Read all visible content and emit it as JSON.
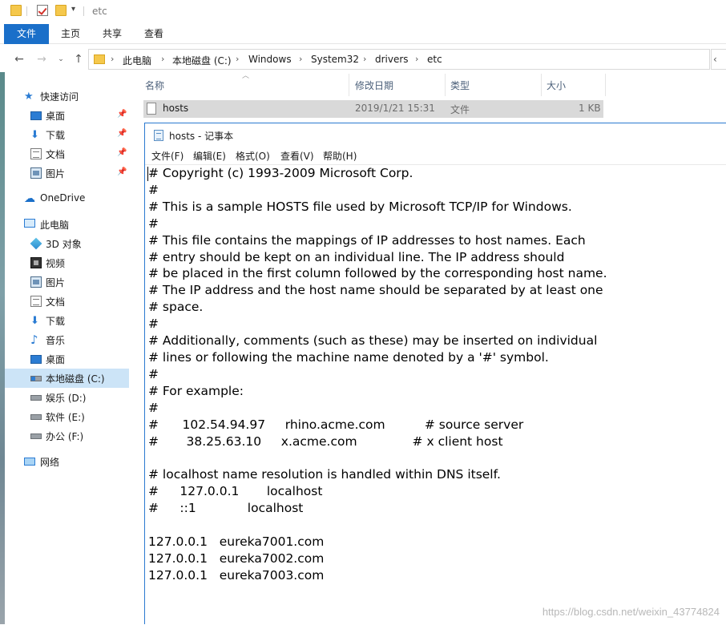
{
  "explorer": {
    "title": "etc",
    "ribbon_tabs": [
      "文件",
      "主页",
      "共享",
      "查看"
    ],
    "breadcrumbs": [
      "此电脑",
      "本地磁盘 (C:)",
      "Windows",
      "System32",
      "drivers",
      "etc"
    ],
    "columns": {
      "name": "名称",
      "modified": "修改日期",
      "type": "类型",
      "size": "大小"
    },
    "files": [
      {
        "name": "hosts",
        "modified": "2019/1/21 15:31",
        "type": "文件",
        "size": "1 KB"
      }
    ],
    "sidebar": {
      "quick_access": "快速访问",
      "quick_items": [
        "桌面",
        "下载",
        "文档",
        "图片"
      ],
      "onedrive": "OneDrive",
      "this_pc": "此电脑",
      "pc_items": [
        "3D 对象",
        "视频",
        "图片",
        "文档",
        "下载",
        "音乐",
        "桌面",
        "本地磁盘 (C:)",
        "娱乐 (D:)",
        "软件 (E:)",
        "办公 (F:)"
      ],
      "network": "网络"
    }
  },
  "notepad": {
    "title": "hosts - 记事本",
    "menu": [
      "文件(F)",
      "编辑(E)",
      "格式(O)",
      "查看(V)",
      "帮助(H)"
    ],
    "content": "# Copyright (c) 1993-2009 Microsoft Corp.\n#\n# This is a sample HOSTS file used by Microsoft TCP/IP for Windows.\n#\n# This file contains the mappings of IP addresses to host names. Each\n# entry should be kept on an individual line. The IP address should\n# be placed in the first column followed by the corresponding host name.\n# The IP address and the host name should be separated by at least one\n# space.\n#\n# Additionally, comments (such as these) may be inserted on individual\n# lines or following the machine name denoted by a '#' symbol.\n#\n# For example:\n#\n#      102.54.94.97     rhino.acme.com          # source server\n#       38.25.63.10     x.acme.com              # x client host\n\n# localhost name resolution is handled within DNS itself.\n#\t127.0.0.1       localhost\n#\t::1             localhost\n\n127.0.0.1   eureka7001.com\n127.0.0.1   eureka7002.com\n127.0.0.1   eureka7003.com"
  },
  "watermark": "https://blog.csdn.net/weixin_43774824"
}
